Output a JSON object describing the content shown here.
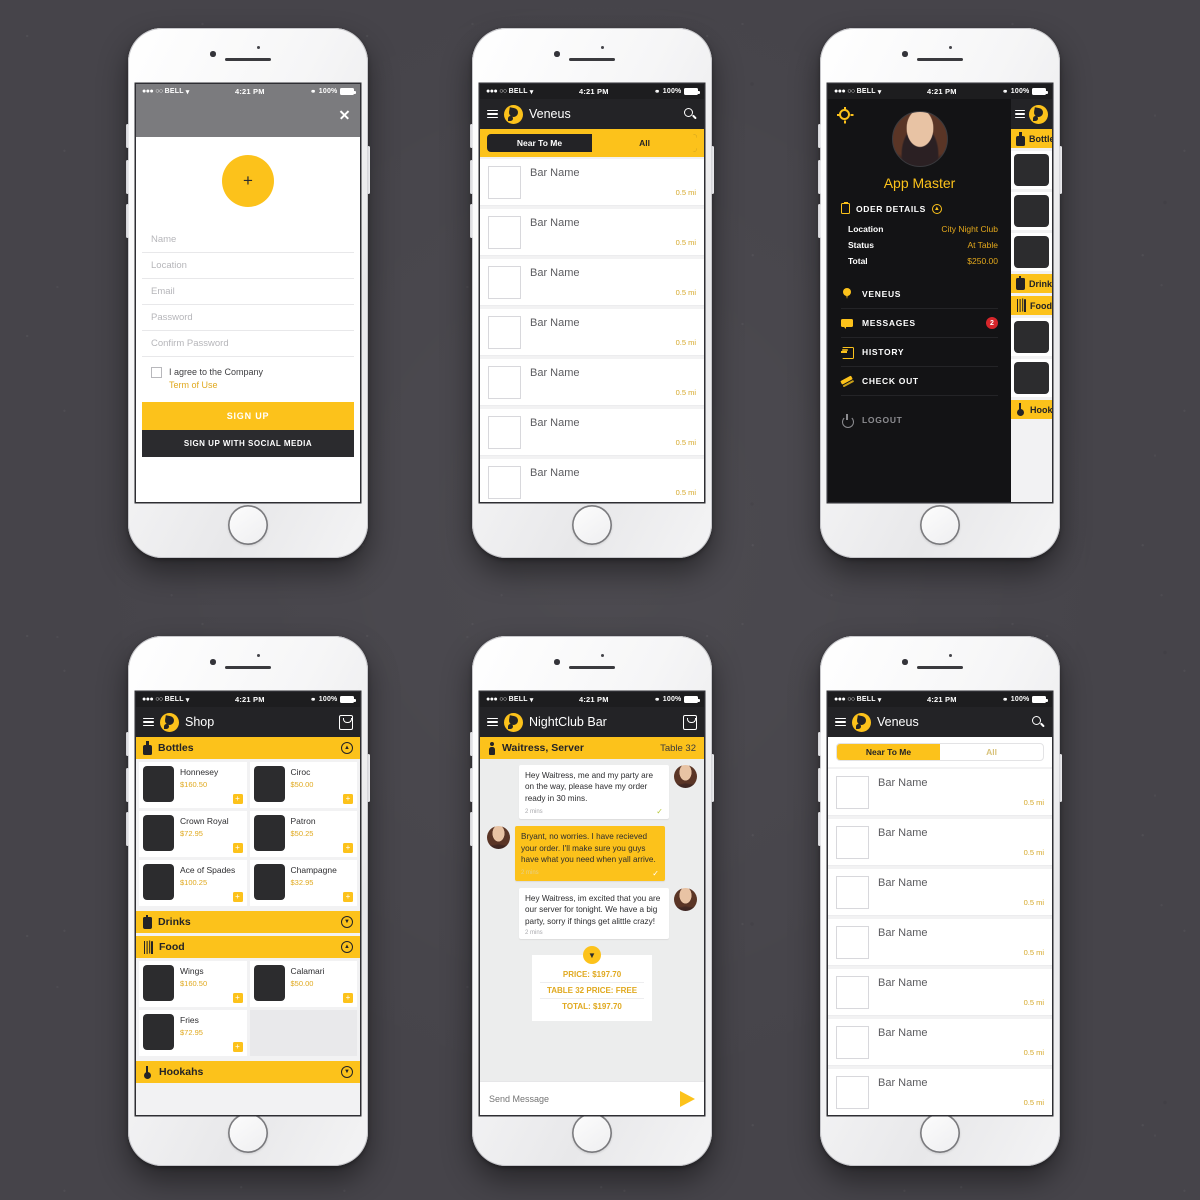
{
  "statusbar": {
    "carrier": "BELL",
    "time": "4:21 PM",
    "battery": "100%",
    "dots_on": "●●●",
    "dots_off": "○○"
  },
  "brand": {
    "yellow": "#fcc21b",
    "dark": "#232326",
    "red": "#d6262b",
    "gray_bg": "#46444a"
  },
  "signup": {
    "close_icon": "close-icon",
    "avatar_add_label": "+",
    "fields": [
      {
        "placeholder": "Name"
      },
      {
        "placeholder": "Location"
      },
      {
        "placeholder": "Email"
      },
      {
        "placeholder": "Password"
      },
      {
        "placeholder": "Confirm Password"
      }
    ],
    "agree_text": "I agree to the Company",
    "terms_link": "Term of Use",
    "signup_button": "SIGN UP",
    "social_button": "SIGN UP WITH SOCIAL MEDIA"
  },
  "venues_dark": {
    "title": "Veneus",
    "search_icon": "search-icon",
    "menu_icon": "hamburger-icon",
    "segments": [
      {
        "label": "Near To Me",
        "active": false
      },
      {
        "label": "All",
        "active": true
      }
    ],
    "rows": [
      {
        "name": "Bar Name",
        "distance": "0.5 mi"
      },
      {
        "name": "Bar Name",
        "distance": "0.5 mi"
      },
      {
        "name": "Bar Name",
        "distance": "0.5 mi"
      },
      {
        "name": "Bar Name",
        "distance": "0.5 mi"
      },
      {
        "name": "Bar Name",
        "distance": "0.5 mi"
      },
      {
        "name": "Bar Name",
        "distance": "0.5 mi"
      },
      {
        "name": "Bar Name",
        "distance": "0.5 mi"
      }
    ]
  },
  "venues_light": {
    "title": "Veneus",
    "segments": [
      {
        "label": "Near To Me",
        "active": true
      },
      {
        "label": "All",
        "active": false
      }
    ],
    "rows": [
      {
        "name": "Bar Name",
        "distance": "0.5 mi"
      },
      {
        "name": "Bar Name",
        "distance": "0.5 mi"
      },
      {
        "name": "Bar Name",
        "distance": "0.5 mi"
      },
      {
        "name": "Bar Name",
        "distance": "0.5 mi"
      },
      {
        "name": "Bar Name",
        "distance": "0.5 mi"
      },
      {
        "name": "Bar Name",
        "distance": "0.5 mi"
      },
      {
        "name": "Bar Name",
        "distance": "0.5 mi"
      }
    ]
  },
  "drawer": {
    "gear_icon": "gear-icon",
    "user_name": "App Master",
    "order_section": {
      "title": "ODER DETAILS",
      "rows": [
        {
          "key": "Location",
          "value": "City Night Club"
        },
        {
          "key": "Status",
          "value": "At Table"
        },
        {
          "key": "Total",
          "value": "$250.00"
        }
      ]
    },
    "items": [
      {
        "label": "VENEUS",
        "icon": "location-pin-icon",
        "badge": ""
      },
      {
        "label": "MESSAGES",
        "icon": "chat-bubble-icon",
        "badge": "2"
      },
      {
        "label": "HISTORY",
        "icon": "history-icon",
        "badge": ""
      },
      {
        "label": "CHECK OUT",
        "icon": "ticket-icon",
        "badge": ""
      },
      {
        "label": "LOGOUT",
        "icon": "power-icon",
        "badge": ""
      }
    ],
    "peek": {
      "categories": [
        {
          "label": "Bottles",
          "icon": "bottle-icon"
        },
        {
          "label": "Drinks",
          "icon": "cup-icon"
        },
        {
          "label": "Food",
          "icon": "fork-knife-icon"
        },
        {
          "label": "Hookahs",
          "icon": "hookah-icon"
        }
      ]
    }
  },
  "shop": {
    "title": "Shop",
    "cart_icon": "shopping-bag-icon",
    "sections": [
      {
        "label": "Bottles",
        "icon": "bottle-icon",
        "expanded": true,
        "toggle": "▲",
        "items": [
          {
            "name": "Honnesey",
            "price": "$160.50"
          },
          {
            "name": "Ciroc",
            "price": "$50.00"
          },
          {
            "name": "Crown Royal",
            "price": "$72.95"
          },
          {
            "name": "Patron",
            "price": "$50.25"
          },
          {
            "name": "Ace of Spades",
            "price": "$100.25"
          },
          {
            "name": "Champagne",
            "price": "$32.95"
          }
        ]
      },
      {
        "label": "Drinks",
        "icon": "cup-icon",
        "expanded": false,
        "toggle": "▼",
        "items": []
      },
      {
        "label": "Food",
        "icon": "fork-knife-icon",
        "expanded": true,
        "toggle": "▲",
        "items": [
          {
            "name": "Wings",
            "price": "$160.50"
          },
          {
            "name": "Calamari",
            "price": "$50.00"
          },
          {
            "name": "Fries",
            "price": "$72.95"
          }
        ]
      },
      {
        "label": "Hookahs",
        "icon": "hookah-icon",
        "expanded": false,
        "toggle": "▼",
        "items": []
      }
    ],
    "add_label": "+"
  },
  "chat": {
    "title": "NightClub Bar",
    "cart_icon": "shopping-bag-icon",
    "role": "Waitress, Server",
    "table": "Table 32",
    "messages": [
      {
        "side": "them",
        "text": "Hey Waitress, me and my party are on the way, please have my order ready in 30 mins.",
        "time": "2 mins",
        "read": "✓"
      },
      {
        "side": "me",
        "text": "Bryant, no worries. I have recieved your order.\nI'll make sure you guys have what you need when yall arrive.",
        "time": "2 mins",
        "read": "✓"
      },
      {
        "side": "them",
        "text": "Hey Waitress, im excited that you are our server for tonight. We have a big party, sorry if things get alittle crazy!",
        "time": "2 mins",
        "read": ""
      }
    ],
    "summary": {
      "toggle": "▼",
      "price_label": "PRICE:",
      "price_value": "$197.70",
      "table_label": "TABLE 32 PRICE:",
      "table_value": "FREE",
      "total_label": "TOTAL:",
      "total_value": "$197.70"
    },
    "input_placeholder": "Send Message",
    "send_icon": "send-arrow-icon"
  }
}
